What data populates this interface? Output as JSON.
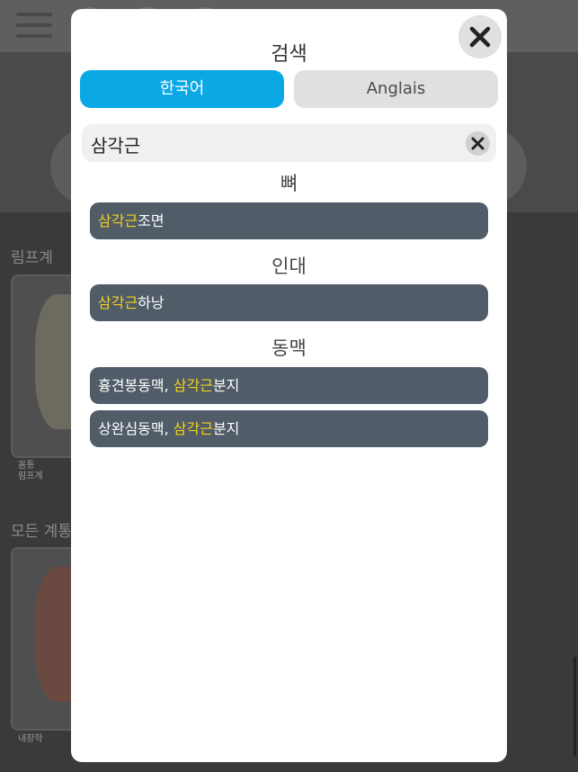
{
  "background": {
    "section_lymph": "림프계",
    "section_all": "모든 계통",
    "card_lymph_caption_1": "몸통",
    "card_lymph_caption_2": "림프계",
    "card_all_caption": "내장학"
  },
  "modal": {
    "title": "검색",
    "close_icon": "close-x",
    "tabs": [
      {
        "label": "한국어",
        "active": true
      },
      {
        "label": "Anglais",
        "active": false
      }
    ],
    "search": {
      "value": "삼각근",
      "clear_icon": "clear-x"
    },
    "highlight_color": "#f3d21d",
    "active_tab_color": "#0aa8e4",
    "result_row_color": "#505c68",
    "sections": [
      {
        "header": "뼈",
        "results": [
          {
            "prefix": "",
            "match": "삼각근",
            "suffix": "조면"
          }
        ]
      },
      {
        "header": "인대",
        "results": [
          {
            "prefix": "",
            "match": "삼각근",
            "suffix": "하낭"
          }
        ]
      },
      {
        "header": "동맥",
        "results": [
          {
            "prefix": "흉견봉동맥, ",
            "match": "삼각근",
            "suffix": "분지"
          },
          {
            "prefix": "상완심동맥, ",
            "match": "삼각근",
            "suffix": "분지"
          }
        ]
      }
    ]
  }
}
